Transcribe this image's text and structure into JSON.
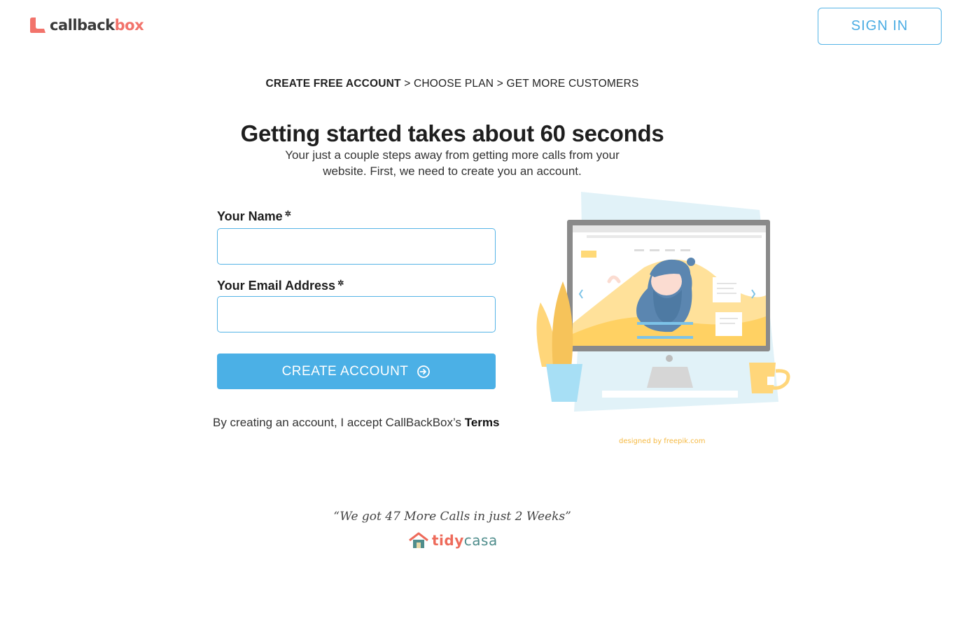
{
  "brand": {
    "name_part1": "callback",
    "name_part2": "box",
    "accent": "#f2736b"
  },
  "header": {
    "signin_label": "SIGN IN"
  },
  "breadcrumb": {
    "step1": "CREATE FREE ACCOUNT",
    "sep1": " > ",
    "step2": "CHOOSE PLAN",
    "sep2": " > ",
    "step3": "GET MORE CUSTOMERS"
  },
  "main": {
    "title": "Getting started takes about 60 seconds",
    "subtitle": "Your just a couple steps away from getting more calls from your website. First, we need to create you an account."
  },
  "form": {
    "name_label": "Your Name",
    "name_value": "",
    "email_label": "Your Email Address",
    "email_value": "",
    "required_mark": "✲",
    "submit_label": "CREATE ACCOUNT",
    "submit_icon": "arrow-circle-right-icon"
  },
  "terms": {
    "text": "By creating an account, I accept CallBackBox’s ",
    "link": "Terms"
  },
  "illustration": {
    "credit": "designed by freepik.com"
  },
  "testimonial": {
    "quote": "“We got 47 More Calls in just 2 Weeks”",
    "company_part1": "tidy",
    "company_part2": "casa"
  },
  "colors": {
    "primary": "#4bb0e6",
    "input_border": "#55b4e6",
    "brand_red": "#f2736b",
    "tidy_teal": "#4f8d8c"
  }
}
